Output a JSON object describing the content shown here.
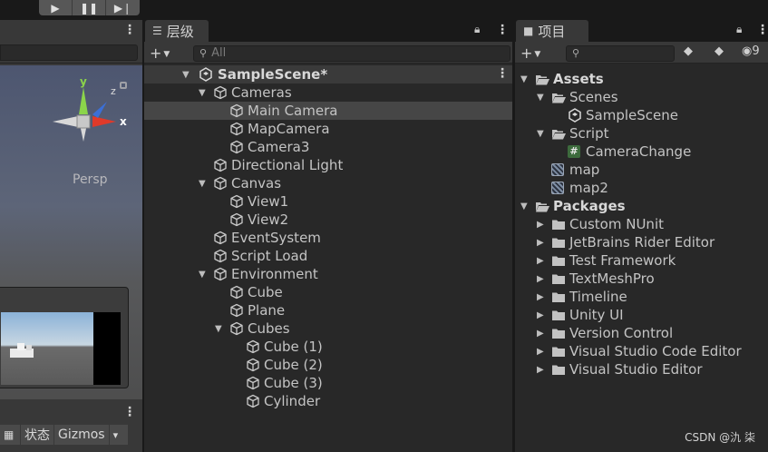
{
  "toolbar": {
    "play_icon": "play-icon",
    "pause_icon": "pause-icon",
    "step_icon": "step-icon"
  },
  "scene": {
    "kebab": "⋮",
    "persp_label": "Persp",
    "gizmo": {
      "y": "y",
      "z": "z",
      "x": "x"
    },
    "bottom_kebab": "⋮",
    "tools": {
      "stats": "状态",
      "gizmos": "Gizmos",
      "dropdown": "▾"
    }
  },
  "hierarchy": {
    "tab_label": "层级",
    "search_placeholder": "All",
    "scene_name": "SampleScene*",
    "items": [
      {
        "label": "Cameras",
        "depth": 1,
        "arrow": "▼"
      },
      {
        "label": "Main Camera",
        "depth": 2,
        "arrow": "",
        "selected": true
      },
      {
        "label": "MapCamera",
        "depth": 2,
        "arrow": ""
      },
      {
        "label": "Camera3",
        "depth": 2,
        "arrow": ""
      },
      {
        "label": "Directional Light",
        "depth": 1,
        "arrow": ""
      },
      {
        "label": "Canvas",
        "depth": 1,
        "arrow": "▼"
      },
      {
        "label": "View1",
        "depth": 2,
        "arrow": ""
      },
      {
        "label": "View2",
        "depth": 2,
        "arrow": ""
      },
      {
        "label": "EventSystem",
        "depth": 1,
        "arrow": ""
      },
      {
        "label": "Script Load",
        "depth": 1,
        "arrow": ""
      },
      {
        "label": "Environment",
        "depth": 1,
        "arrow": "▼"
      },
      {
        "label": "Cube",
        "depth": 2,
        "arrow": ""
      },
      {
        "label": "Plane",
        "depth": 2,
        "arrow": ""
      },
      {
        "label": "Cubes",
        "depth": 2,
        "arrow": "▼"
      },
      {
        "label": "Cube (1)",
        "depth": 3,
        "arrow": ""
      },
      {
        "label": "Cube (2)",
        "depth": 3,
        "arrow": ""
      },
      {
        "label": "Cube (3)",
        "depth": 3,
        "arrow": ""
      },
      {
        "label": "Cylinder",
        "depth": 3,
        "arrow": ""
      }
    ]
  },
  "project": {
    "tab_label": "项目",
    "hidden_count": "9",
    "items": [
      {
        "label": "Assets",
        "depth": 0,
        "arrow": "▼",
        "icon": "folder-open-icon",
        "bold": true
      },
      {
        "label": "Scenes",
        "depth": 1,
        "arrow": "▼",
        "icon": "folder-open-icon"
      },
      {
        "label": "SampleScene",
        "depth": 2,
        "arrow": "",
        "icon": "unity-scene-icon"
      },
      {
        "label": "Script",
        "depth": 1,
        "arrow": "▼",
        "icon": "folder-open-icon"
      },
      {
        "label": "CameraChange",
        "depth": 2,
        "arrow": "",
        "icon": "csharp-script-icon"
      },
      {
        "label": "map",
        "depth": 1,
        "arrow": "",
        "icon": "render-texture-icon"
      },
      {
        "label": "map2",
        "depth": 1,
        "arrow": "",
        "icon": "render-texture-icon"
      },
      {
        "label": "Packages",
        "depth": 0,
        "arrow": "▼",
        "icon": "folder-open-icon",
        "bold": true
      },
      {
        "label": "Custom NUnit",
        "depth": 1,
        "arrow": "▶",
        "icon": "folder-icon"
      },
      {
        "label": "JetBrains Rider Editor",
        "depth": 1,
        "arrow": "▶",
        "icon": "folder-icon"
      },
      {
        "label": "Test Framework",
        "depth": 1,
        "arrow": "▶",
        "icon": "folder-icon"
      },
      {
        "label": "TextMeshPro",
        "depth": 1,
        "arrow": "▶",
        "icon": "folder-icon"
      },
      {
        "label": "Timeline",
        "depth": 1,
        "arrow": "▶",
        "icon": "folder-icon"
      },
      {
        "label": "Unity UI",
        "depth": 1,
        "arrow": "▶",
        "icon": "folder-icon"
      },
      {
        "label": "Version Control",
        "depth": 1,
        "arrow": "▶",
        "icon": "folder-icon"
      },
      {
        "label": "Visual Studio Code Editor",
        "depth": 1,
        "arrow": "▶",
        "icon": "folder-icon"
      },
      {
        "label": "Visual Studio Editor",
        "depth": 1,
        "arrow": "▶",
        "icon": "folder-icon"
      }
    ]
  },
  "watermark": "CSDN @氿  柒",
  "colors": {
    "panel_bg": "#282828",
    "header_bg": "#383838",
    "selection_bg": "#464646",
    "text": "#c4c4c4"
  }
}
